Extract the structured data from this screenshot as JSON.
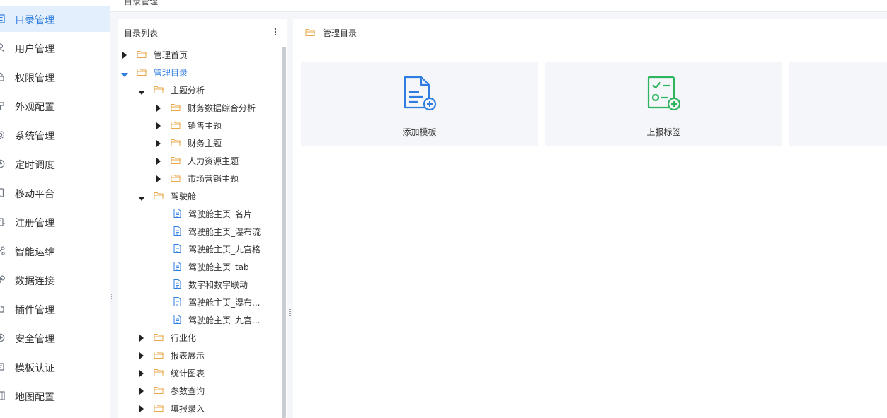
{
  "breadcrumb": "目录管理",
  "colors": {
    "accent": "#2f7de1",
    "folder": "#e9a84c",
    "green": "#2db55d",
    "active_bg": "#e3effd"
  },
  "sidebar": {
    "items": [
      {
        "label": "目录管理",
        "icon": "list-icon",
        "active": true
      },
      {
        "label": "用户管理",
        "icon": "user-icon"
      },
      {
        "label": "权限管理",
        "icon": "lock-icon"
      },
      {
        "label": "外观配置",
        "icon": "brush-icon"
      },
      {
        "label": "系统管理",
        "icon": "gear-icon"
      },
      {
        "label": "定时调度",
        "icon": "clock-icon"
      },
      {
        "label": "移动平台",
        "icon": "mobile-icon"
      },
      {
        "label": "注册管理",
        "icon": "register-icon"
      },
      {
        "label": "智能运维",
        "icon": "network-icon"
      },
      {
        "label": "数据连接",
        "icon": "link-icon"
      },
      {
        "label": "插件管理",
        "icon": "plugin-icon"
      },
      {
        "label": "安全管理",
        "icon": "shield-icon"
      },
      {
        "label": "模板认证",
        "icon": "template-icon"
      },
      {
        "label": "地图配置",
        "icon": "map-icon"
      }
    ]
  },
  "tree": {
    "title": "目录列表",
    "more_icon": "more-vertical-icon",
    "nodes": [
      {
        "label": "管理首页",
        "level": 0,
        "type": "folder",
        "state": "collapsed"
      },
      {
        "label": "管理目录",
        "level": 0,
        "type": "folder",
        "state": "expanded",
        "selected": true
      },
      {
        "label": "主题分析",
        "level": 1,
        "type": "folder",
        "state": "expanded"
      },
      {
        "label": "财务数据综合分析",
        "level": 2,
        "type": "folder",
        "state": "collapsed"
      },
      {
        "label": "销售主题",
        "level": 2,
        "type": "folder",
        "state": "collapsed"
      },
      {
        "label": "财务主题",
        "level": 2,
        "type": "folder",
        "state": "collapsed"
      },
      {
        "label": "人力资源主题",
        "level": 2,
        "type": "folder",
        "state": "collapsed"
      },
      {
        "label": "市场营销主题",
        "level": 2,
        "type": "folder",
        "state": "collapsed"
      },
      {
        "label": "驾驶舱",
        "level": 1,
        "type": "folder",
        "state": "expanded"
      },
      {
        "label": "驾驶舱主页_名片",
        "level": 2,
        "type": "file"
      },
      {
        "label": "驾驶舱主页_瀑布流",
        "level": 2,
        "type": "file"
      },
      {
        "label": "驾驶舱主页_九宫格",
        "level": 2,
        "type": "file"
      },
      {
        "label": "驾驶舱主页_tab",
        "level": 2,
        "type": "file"
      },
      {
        "label": "数字和数字联动",
        "level": 2,
        "type": "file"
      },
      {
        "label": "驾驶舱主页_瀑布...",
        "level": 2,
        "type": "file"
      },
      {
        "label": "驾驶舱主页_九宫...",
        "level": 2,
        "type": "file"
      },
      {
        "label": "行业化",
        "level": 1,
        "type": "folder",
        "state": "collapsed"
      },
      {
        "label": "报表展示",
        "level": 1,
        "type": "folder",
        "state": "collapsed"
      },
      {
        "label": "统计图表",
        "level": 1,
        "type": "folder",
        "state": "collapsed"
      },
      {
        "label": "参数查询",
        "level": 1,
        "type": "folder",
        "state": "collapsed"
      },
      {
        "label": "填报录入",
        "level": 1,
        "type": "folder",
        "state": "collapsed"
      }
    ]
  },
  "main": {
    "title": "管理目录",
    "cards": [
      {
        "label": "添加模板",
        "icon": "add-template-icon"
      },
      {
        "label": "上报标签",
        "icon": "report-tag-icon"
      },
      {
        "label": "",
        "icon": ""
      }
    ]
  }
}
